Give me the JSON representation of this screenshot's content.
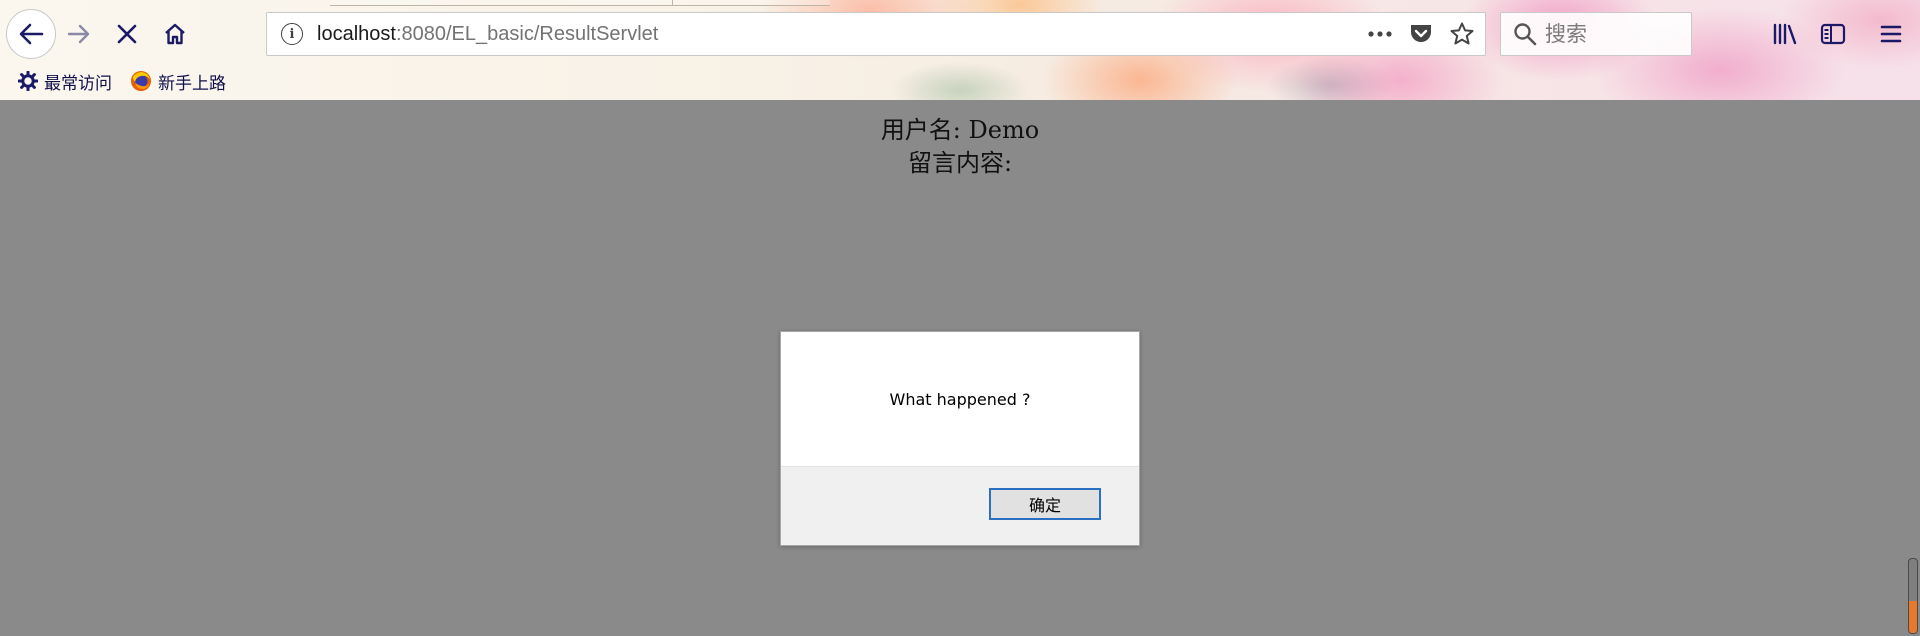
{
  "browser": {
    "url_host": "localhost",
    "url_rest": ":8080/EL_basic/ResultServlet",
    "search_placeholder": "搜索",
    "bookmarks": [
      {
        "label": "最常访问",
        "icon": "gear-icon"
      },
      {
        "label": "新手上路",
        "icon": "firefox-icon"
      }
    ]
  },
  "page": {
    "username_label": "用户名: Demo",
    "message_label": "留言内容:"
  },
  "dialog": {
    "message": "What happened ?",
    "ok_label": "确定"
  },
  "colors": {
    "page_background": "#8a8a8a",
    "dialog_button_border": "#2a6fc4",
    "toolbar_icon": "#1a1a66"
  }
}
